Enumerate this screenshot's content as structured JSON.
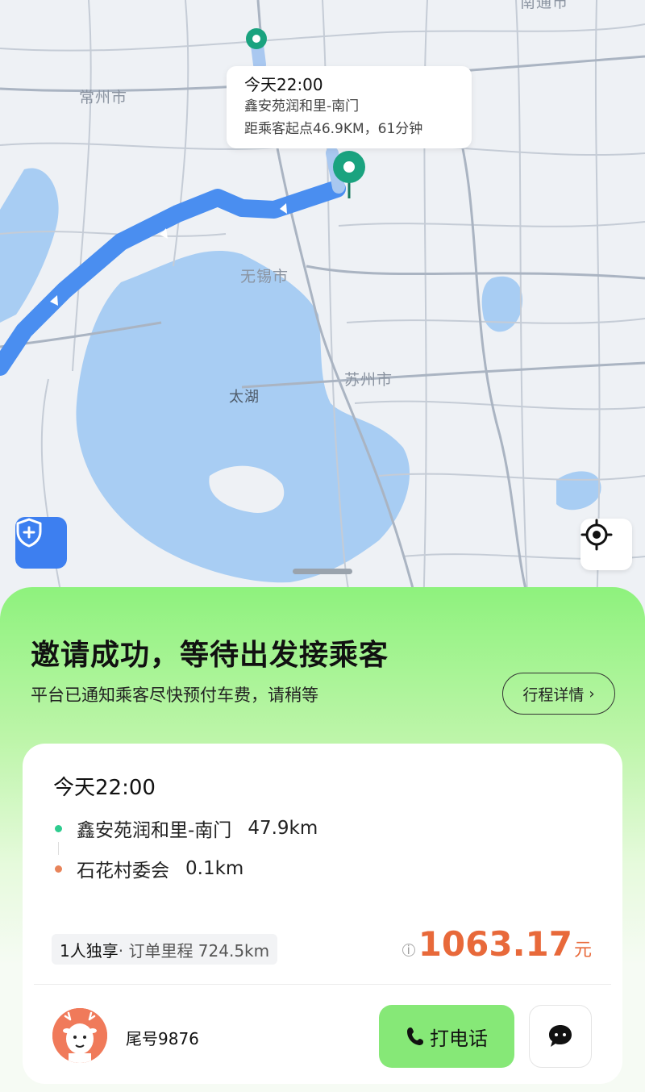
{
  "map": {
    "labels": {
      "changzhou": "常州市",
      "wuxi": "无锡市",
      "suzhou": "苏州市",
      "taihu": "太湖",
      "nantong": "南通市"
    },
    "callout": {
      "time": "今天22:00",
      "place": "鑫安苑润和里-南门",
      "distance": "距乘客起点46.9KM，61分钟"
    },
    "route_color": "#4a8ef0",
    "pin_color": "#1aa37f",
    "icons": {
      "safety": "shield-plus-icon",
      "locate": "crosshair-icon"
    }
  },
  "panel": {
    "headline": "邀请成功，等待出发接乘客",
    "subline": "平台已通知乘客尽快预付车费，请稍等",
    "detail_button": "行程详情",
    "detail_chevron": "›",
    "card": {
      "time": "今天22:00",
      "pickup": {
        "name": "鑫安苑润和里-南门",
        "distance": "47.9km",
        "color": "#2ecc8f"
      },
      "dropoff": {
        "name": "石花村委会",
        "distance": "0.1km",
        "color": "#e8845a"
      },
      "tag_primary": "1人独享",
      "tag_secondary": " · 订单里程 724.5km",
      "price_info_icon": "i",
      "price": "1063.17",
      "price_unit": "元",
      "price_color": "#e8693a",
      "passenger_tail": "尾号9876",
      "call_button": "打电话",
      "icons": {
        "avatar": "deer-avatar-icon",
        "phone": "phone-icon",
        "message": "chat-bubble-icon"
      }
    }
  }
}
